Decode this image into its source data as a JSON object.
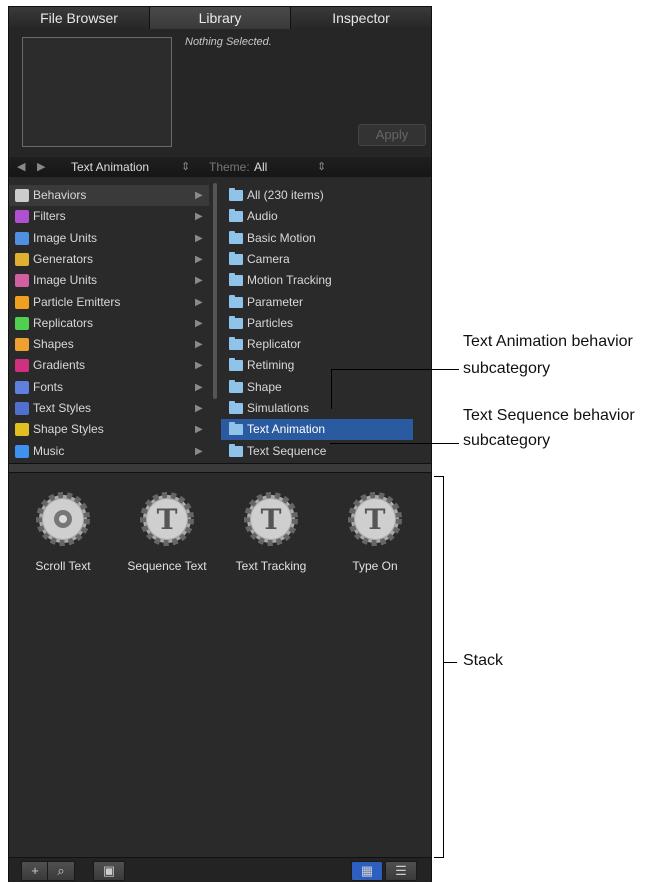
{
  "tabs": [
    "File Browser",
    "Library",
    "Inspector"
  ],
  "preview": {
    "status_text": "Nothing Selected.",
    "apply_label": "Apply"
  },
  "navbar": {
    "category_label": "Text Animation",
    "theme_label": "Theme:",
    "theme_value": "All"
  },
  "categories": [
    {
      "label": "Behaviors",
      "icon": "gear-icon",
      "color": "#cccccc"
    },
    {
      "label": "Filters",
      "icon": "filters-icon",
      "color": "#b050d0"
    },
    {
      "label": "Image Units",
      "icon": "image-units-icon",
      "color": "#5090e0"
    },
    {
      "label": "Generators",
      "icon": "generators-icon",
      "color": "#e0b030"
    },
    {
      "label": "Image Units",
      "icon": "image-units-icon",
      "color": "#d060a0"
    },
    {
      "label": "Particle Emitters",
      "icon": "particles-icon",
      "color": "#f0a020"
    },
    {
      "label": "Replicators",
      "icon": "replicators-icon",
      "color": "#50d050"
    },
    {
      "label": "Shapes",
      "icon": "shapes-icon",
      "color": "#f0a030"
    },
    {
      "label": "Gradients",
      "icon": "gradients-icon",
      "color": "#d03080"
    },
    {
      "label": "Fonts",
      "icon": "fonts-icon",
      "color": "#6080e0"
    },
    {
      "label": "Text Styles",
      "icon": "text-styles-icon",
      "color": "#5070d0"
    },
    {
      "label": "Shape Styles",
      "icon": "shape-styles-icon",
      "color": "#e0c020"
    },
    {
      "label": "Music",
      "icon": "music-icon",
      "color": "#4090f0"
    }
  ],
  "subcategories": [
    "All (230 items)",
    "Audio",
    "Basic Motion",
    "Camera",
    "Motion Tracking",
    "Parameter",
    "Particles",
    "Replicator",
    "Retiming",
    "Shape",
    "Simulations",
    "Text Animation",
    "Text Sequence"
  ],
  "selected_subcategory": "Text Animation",
  "stack_items": [
    "Scroll Text",
    "Sequence Text",
    "Text Tracking",
    "Type On"
  ],
  "annotations": {
    "text_animation_1": "Text Animation behavior",
    "text_animation_2": "subcategory",
    "text_sequence_1": "Text Sequence behavior",
    "text_sequence_2": "subcategory",
    "stack": "Stack"
  },
  "toolbar": {
    "add": "+",
    "search": "⌕",
    "preview": "▣",
    "grid": "▦",
    "list": "☰"
  }
}
